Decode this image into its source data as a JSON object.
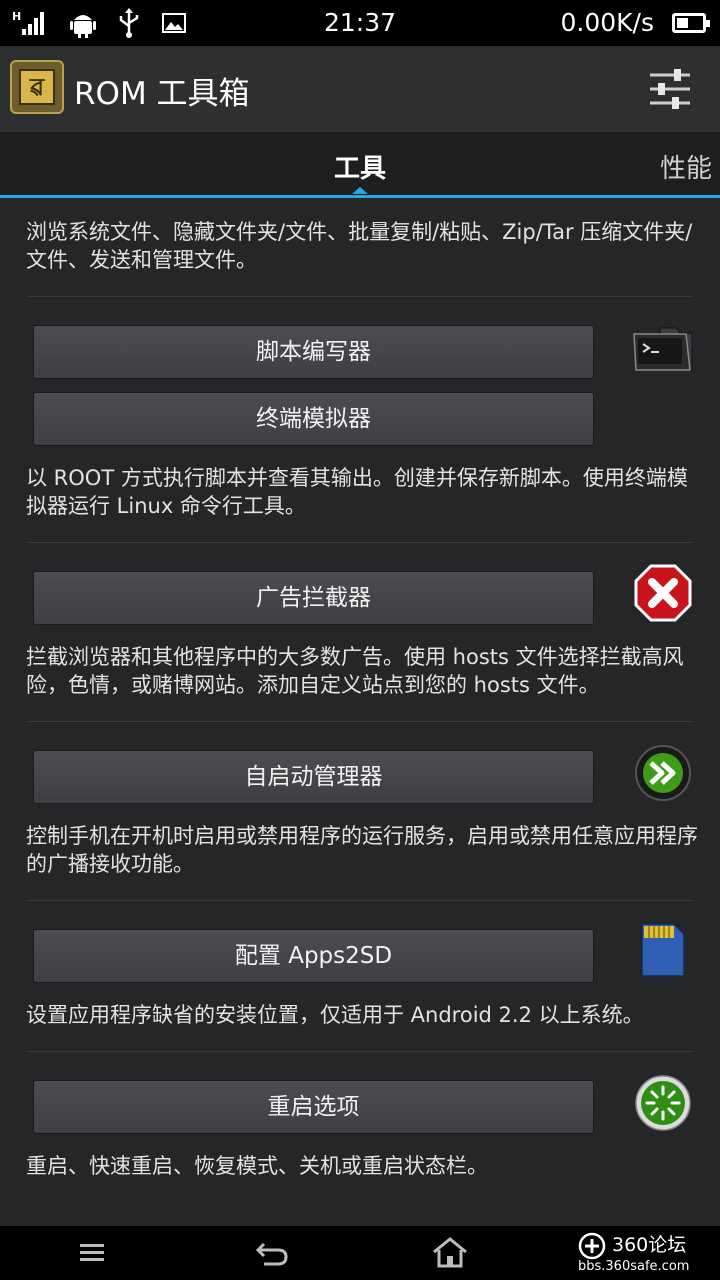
{
  "status_bar": {
    "time": "21:37",
    "network_speed": "0.00K/s"
  },
  "app_bar": {
    "title": "ROM 工具箱",
    "icon_glyph": "ৱ"
  },
  "tabs": {
    "active": "工具",
    "next": "性能"
  },
  "content": {
    "intro": "浏览系统文件、隐藏文件夹/文件、批量复制/粘贴、Zip/Tar 压缩文件夹/文件、发送和管理文件。",
    "sections": [
      {
        "buttons": [
          "脚本编写器",
          "终端模拟器"
        ],
        "description": "以 ROOT 方式执行脚本并查看其输出。创建并保存新脚本。使用终端模拟器运行 Linux 命令行工具。",
        "icon": "terminal-folder-icon"
      },
      {
        "buttons": [
          "广告拦截器"
        ],
        "description": "拦截浏览器和其他程序中的大多数广告。使用 hosts 文件选择拦截高风险，色情，或赌博网站。添加自定义站点到您的 hosts 文件。",
        "icon": "red-x-block-icon"
      },
      {
        "buttons": [
          "自启动管理器"
        ],
        "description": "控制手机在开机时启用或禁用程序的运行服务，启用或禁用任意应用程序的广播接收功能。",
        "icon": "green-fast-forward-icon"
      },
      {
        "buttons": [
          "配置 Apps2SD"
        ],
        "description": "设置应用程序缺省的安装位置，仅适用于 Android 2.2 以上系统。",
        "icon": "sd-card-icon"
      },
      {
        "buttons": [
          "重启选项"
        ],
        "description": "重启、快速重启、恢复模式、关机或重启状态栏。",
        "icon": "green-reboot-icon"
      }
    ]
  },
  "watermark": {
    "main": "360论坛",
    "sub": "bbs.360safe.com"
  },
  "colors": {
    "accent": "#2aa6de",
    "button": "#46474a",
    "background": "#252628"
  }
}
